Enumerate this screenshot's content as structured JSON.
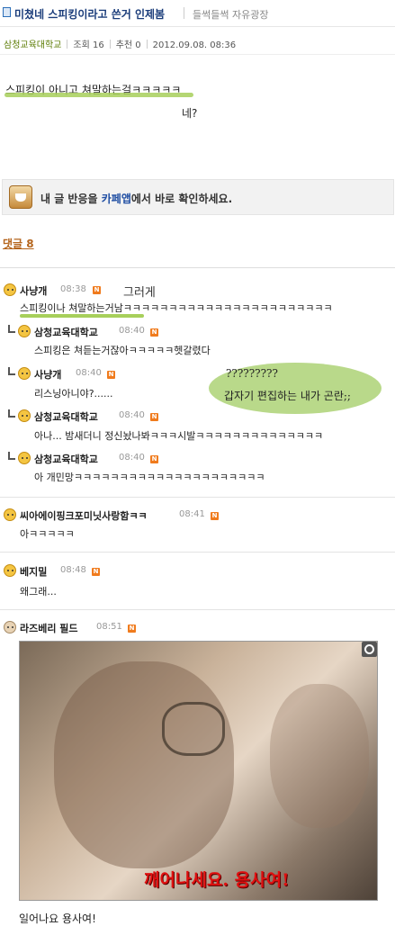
{
  "header": {
    "title": "미쳤네 스피킹이라고 쓴거 인제봄",
    "board": "들썩들썩 자유광장"
  },
  "meta": {
    "author": "삼청교육대학교",
    "views": "조회 16",
    "recommend": "추천 0",
    "datetime": "2012.09.08. 08:36"
  },
  "post": {
    "line1": "스피킹이 아니고 쳐말하는걸ㅋㅋㅋㅋㅋ",
    "line2": "네?"
  },
  "cafe_banner": {
    "prefix": "내 글 반응을 ",
    "link": "카페앱",
    "suffix": "에서 바로 확인하세요."
  },
  "comments_head": "댓글 8",
  "comments": [
    {
      "nick": "사냥개",
      "time": "08:38",
      "text": "스피킹이나 쳐말하는거남ㅋㅋㅋㅋㅋㅋㅋㅋㅋㅋㅋㅋㅋㅋㅋㅋㅋㅋㅋㅋㅋㅋㅋ"
    },
    {
      "nick": "삼청교육대학교",
      "time": "08:40",
      "text": "스피킹은 쳐듣는거잖아ㅋㅋㅋㅋㅋ헷갈렸다"
    },
    {
      "nick": "사냥개",
      "time": "08:40",
      "text": "리스닝아니야?......"
    },
    {
      "nick": "삼청교육대학교",
      "time": "08:40",
      "text": "아나... 밤새더니 정신놨나봐ㅋㅋㅋ시발ㅋㅋㅋㅋㅋㅋㅋㅋㅋㅋㅋㅋㅋㅋ"
    },
    {
      "nick": "삼청교육대학교",
      "time": "08:40",
      "text": "아 개민망ㅋㅋㅋㅋㅋㅋㅋㅋㅋㅋㅋㅋㅋㅋㅋㅋㅋㅋㅋㅋㅋ"
    },
    {
      "nick": "씨아에이핑크포미닛사랑함ㅋㅋ",
      "time": "08:41",
      "text": "아ㅋㅋㅋㅋㅋ"
    },
    {
      "nick": "베지밀",
      "time": "08:48",
      "text": "왜그래..."
    },
    {
      "nick": "라즈베리 필드",
      "time": "08:51",
      "text": "일어나요 용사여!"
    }
  ],
  "new_badge": "N",
  "handwritten": {
    "note1": "그러게",
    "bubble_q": "?????????",
    "bubble_text": "갑자기 편집하는 내가 곤란;;"
  },
  "photo": {
    "caption": "깨어나세요. 용사여!"
  },
  "icons": {
    "title": "document-icon",
    "zoom": "zoom-icon",
    "cafe": "cafe-app-icon"
  }
}
